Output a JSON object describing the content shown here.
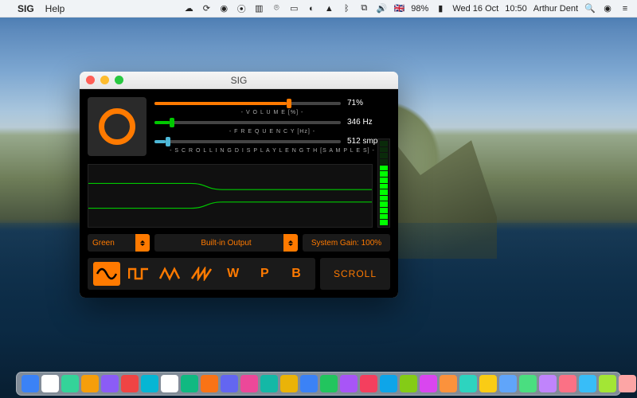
{
  "menubar": {
    "app_name": "SIG",
    "menus": [
      "Help"
    ],
    "battery": "98%",
    "date": "Wed 16 Oct",
    "time": "10:50",
    "user": "Arthur Dent"
  },
  "window": {
    "title": "SIG"
  },
  "sliders": {
    "volume": {
      "label": "- V O L U M E  [%] -",
      "value_text": "71%",
      "percent": 71
    },
    "frequency": {
      "label": "- F R E Q U E N C Y  [Hz] -",
      "value_text": "346 Hz",
      "percent": 8
    },
    "samples": {
      "label": "- S C R O L L I N G   D I S P L A Y   L E N G T H   [S A M P L E S] -",
      "value_text": "512 smp",
      "percent": 6
    }
  },
  "selectors": {
    "color": "Green",
    "output": "Built-in Output",
    "gain": "System Gain: 100%"
  },
  "wave_buttons": {
    "sine": "sine",
    "square": "square",
    "triangle": "triangle",
    "saw": "saw",
    "w": "W",
    "p": "P",
    "b": "B"
  },
  "scroll_button": "SCROLL",
  "meter": {
    "segments": 14,
    "lit": 10
  },
  "colors": {
    "accent": "#ff7a00",
    "scope_trace": "#00c800"
  },
  "dock_colors": [
    "#3b82f6",
    "#ffffff",
    "#34d399",
    "#f59e0b",
    "#8b5cf6",
    "#ef4444",
    "#06b6d4",
    "#ffffff",
    "#10b981",
    "#f97316",
    "#6366f1",
    "#ec4899",
    "#14b8a6",
    "#eab308",
    "#3b82f6",
    "#22c55e",
    "#a855f7",
    "#f43f5e",
    "#0ea5e9",
    "#84cc16",
    "#d946ef",
    "#fb923c",
    "#2dd4bf",
    "#facc15",
    "#60a5fa",
    "#4ade80",
    "#c084fc",
    "#fb7185",
    "#38bdf8",
    "#a3e635",
    "#fca5a5",
    "#5eead4",
    "#93c5fd",
    "#fde047",
    "#f472b6",
    "#7dd3fc",
    "#bef264",
    "#ffffff",
    "#cbd5e1"
  ]
}
